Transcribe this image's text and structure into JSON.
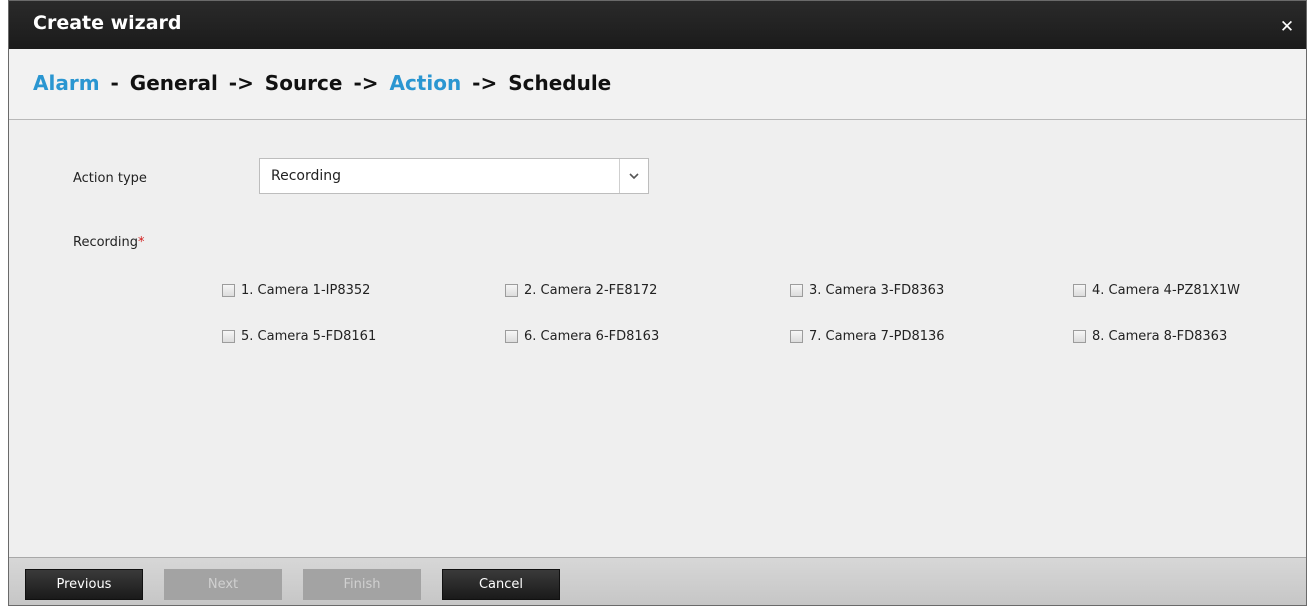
{
  "dialog": {
    "title": "Create wizard"
  },
  "steps": {
    "alarm": "Alarm",
    "dash": "-",
    "general": "General",
    "arrow1": "->",
    "source": "Source",
    "arrow2": "->",
    "action": "Action",
    "arrow3": "->",
    "schedule": "Schedule"
  },
  "form": {
    "action_type_label": "Action type",
    "action_type_value": "Recording",
    "recording_label": "Recording",
    "required_mark": "*"
  },
  "cameras": [
    {
      "label": "1. Camera 1-IP8352",
      "checked": false
    },
    {
      "label": "2. Camera 2-FE8172",
      "checked": false
    },
    {
      "label": "3. Camera 3-FD8363",
      "checked": false
    },
    {
      "label": "4. Camera 4-PZ81X1W",
      "checked": false
    },
    {
      "label": "5. Camera 5-FD8161",
      "checked": false
    },
    {
      "label": "6. Camera 6-FD8163",
      "checked": false
    },
    {
      "label": "7. Camera 7-PD8136",
      "checked": false
    },
    {
      "label": "8. Camera 8-FD8363",
      "checked": false
    }
  ],
  "footer": {
    "previous": "Previous",
    "next": "Next",
    "finish": "Finish",
    "cancel": "Cancel"
  },
  "colors": {
    "accent": "#2a96d1",
    "required": "#d21b1b",
    "titlebar": "#1f1f1f"
  }
}
